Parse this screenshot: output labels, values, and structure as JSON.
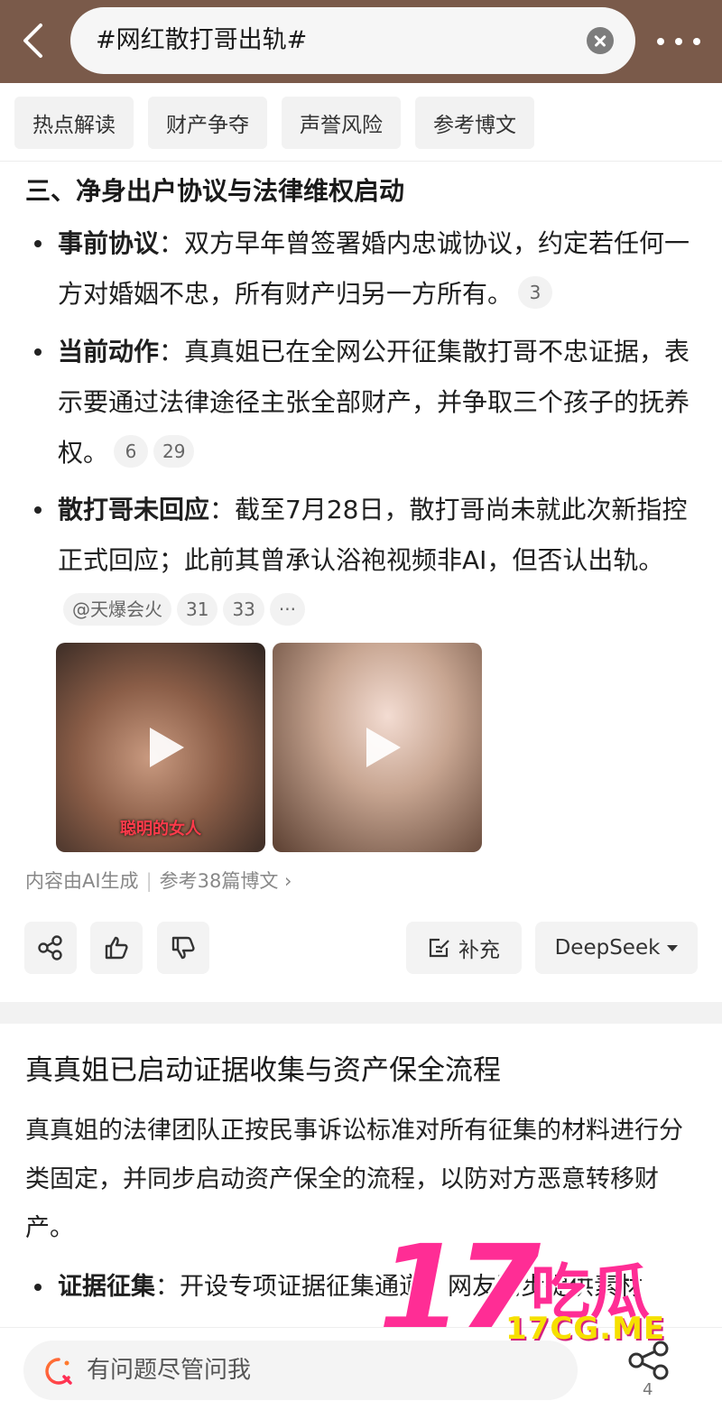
{
  "search": {
    "query": "#网红散打哥出轨#"
  },
  "tabs": [
    {
      "label": "热点解读"
    },
    {
      "label": "财产争夺"
    },
    {
      "label": "声誉风险"
    },
    {
      "label": "参考博文"
    }
  ],
  "section": {
    "heading": "三、净身出户协议与法律维权启动",
    "items": [
      {
        "title": "事前协议",
        "colon": "：",
        "text": "双方早年曾签署婚内忠诚协议，约定若任何一方对婚姻不忠，所有财产归另一方所有。",
        "refs": [
          "3"
        ]
      },
      {
        "title": "当前动作",
        "colon": "：",
        "text": "真真姐已在全网公开征集散打哥不忠证据，表示要通过法律途径主张全部财产，并争取三个孩子的抚养权。",
        "refs": [
          "6",
          "29"
        ]
      },
      {
        "title": "散打哥未回应",
        "colon": "：",
        "text": "截至7月28日，散打哥尚未就此次新指控正式回应；此前其曾承认浴袍视频非AI，但否认出轨。",
        "refs": [
          "@天爆会火",
          "31",
          "33",
          "···"
        ]
      }
    ]
  },
  "videos": [
    {
      "caption": "聪明的女人"
    },
    {
      "caption": ""
    }
  ],
  "ai_note": {
    "generated": "内容由AI生成",
    "sources": "参考38篇博文 ›"
  },
  "actions": {
    "supplement_label": "补充",
    "model_label": "DeepSeek"
  },
  "card": {
    "title": "真真姐已启动证据收集与资产保全流程",
    "paragraph": "真真姐的法律团队正按民事诉讼标准对所有征集的材料进行分类固定，并同步启动资产保全的流程，以防对方恶意转移财产。",
    "bullet_title": "证据征集",
    "bullet_colon": "：",
    "bullet_text": "开设专项证据征集通道，网友同步提供素材"
  },
  "bottom": {
    "placeholder": "有问题尽管问我",
    "share_count": "4"
  },
  "watermark": {
    "number": "17",
    "chinese": "吃瓜",
    "url": "17CG.ME"
  },
  "colors": {
    "topbar": "#7a5a4a",
    "accent_pink": "#ff2d95",
    "accent_yellow": "#f6e000"
  }
}
